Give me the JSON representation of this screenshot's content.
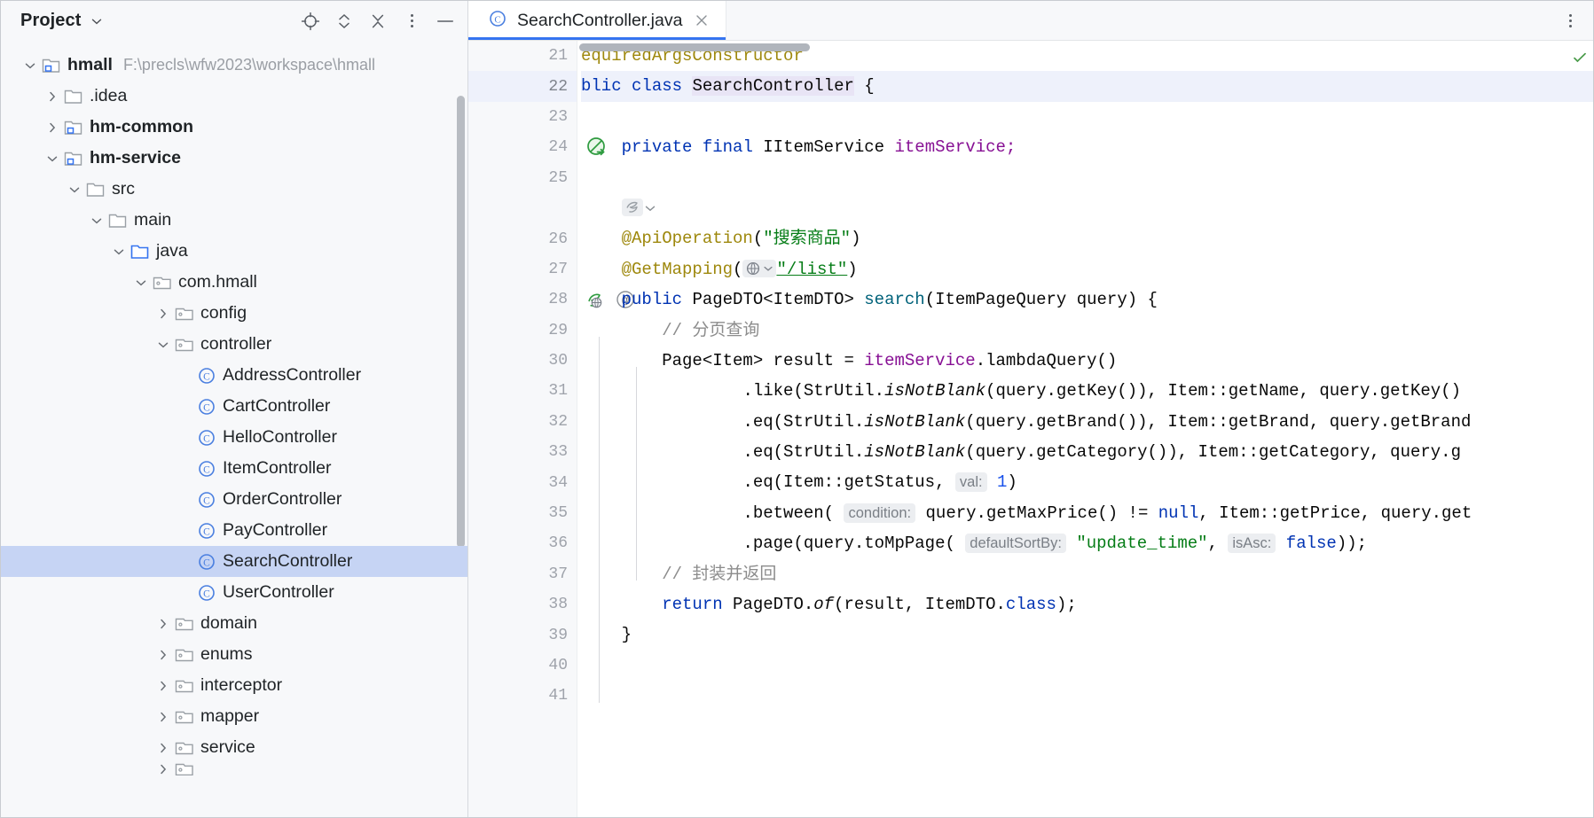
{
  "tool_window": {
    "title": "Project",
    "title_chevron_icon": "chevron-down-icon",
    "actions": [
      {
        "name": "locate-in-tree-icon",
        "label": "Select Opened File"
      },
      {
        "name": "expand-collapse-icon",
        "label": "Expand / Collapse"
      },
      {
        "name": "collapse-all-icon",
        "label": "Collapse All"
      },
      {
        "name": "more-options-icon",
        "label": "Options"
      },
      {
        "name": "hide-icon",
        "label": "Hide"
      }
    ]
  },
  "tree": {
    "nodes": [
      {
        "label": "hmall",
        "path": "F:\\precls\\wfw2023\\workspace\\hmall",
        "icon": "module-folder-icon",
        "depth": 0,
        "twisty": "expanded",
        "bold": true,
        "selected": false
      },
      {
        "label": ".idea",
        "path": "",
        "icon": "folder-icon",
        "depth": 1,
        "twisty": "collapsed",
        "bold": false,
        "selected": false
      },
      {
        "label": "hm-common",
        "path": "",
        "icon": "module-folder-icon",
        "depth": 1,
        "twisty": "collapsed",
        "bold": true,
        "selected": false
      },
      {
        "label": "hm-service",
        "path": "",
        "icon": "module-folder-icon",
        "depth": 1,
        "twisty": "expanded",
        "bold": true,
        "selected": false
      },
      {
        "label": "src",
        "path": "",
        "icon": "folder-icon",
        "depth": 2,
        "twisty": "expanded",
        "bold": false,
        "selected": false
      },
      {
        "label": "main",
        "path": "",
        "icon": "folder-icon",
        "depth": 3,
        "twisty": "expanded",
        "bold": false,
        "selected": false
      },
      {
        "label": "java",
        "path": "",
        "icon": "source-root-folder-icon",
        "depth": 4,
        "twisty": "expanded",
        "bold": false,
        "selected": false
      },
      {
        "label": "com.hmall",
        "path": "",
        "icon": "package-icon",
        "depth": 5,
        "twisty": "expanded",
        "bold": false,
        "selected": false
      },
      {
        "label": "config",
        "path": "",
        "icon": "package-icon",
        "depth": 6,
        "twisty": "collapsed",
        "bold": false,
        "selected": false
      },
      {
        "label": "controller",
        "path": "",
        "icon": "package-icon",
        "depth": 6,
        "twisty": "expanded",
        "bold": false,
        "selected": false
      },
      {
        "label": "AddressController",
        "path": "",
        "icon": "java-class-icon",
        "depth": 7,
        "twisty": "none",
        "bold": false,
        "selected": false
      },
      {
        "label": "CartController",
        "path": "",
        "icon": "java-class-icon",
        "depth": 7,
        "twisty": "none",
        "bold": false,
        "selected": false
      },
      {
        "label": "HelloController",
        "path": "",
        "icon": "java-class-icon",
        "depth": 7,
        "twisty": "none",
        "bold": false,
        "selected": false
      },
      {
        "label": "ItemController",
        "path": "",
        "icon": "java-class-icon",
        "depth": 7,
        "twisty": "none",
        "bold": false,
        "selected": false
      },
      {
        "label": "OrderController",
        "path": "",
        "icon": "java-class-icon",
        "depth": 7,
        "twisty": "none",
        "bold": false,
        "selected": false
      },
      {
        "label": "PayController",
        "path": "",
        "icon": "java-class-icon",
        "depth": 7,
        "twisty": "none",
        "bold": false,
        "selected": false
      },
      {
        "label": "SearchController",
        "path": "",
        "icon": "java-class-icon",
        "depth": 7,
        "twisty": "none",
        "bold": false,
        "selected": true
      },
      {
        "label": "UserController",
        "path": "",
        "icon": "java-class-icon",
        "depth": 7,
        "twisty": "none",
        "bold": false,
        "selected": false
      },
      {
        "label": "domain",
        "path": "",
        "icon": "package-icon",
        "depth": 6,
        "twisty": "collapsed",
        "bold": false,
        "selected": false
      },
      {
        "label": "enums",
        "path": "",
        "icon": "package-icon",
        "depth": 6,
        "twisty": "collapsed",
        "bold": false,
        "selected": false
      },
      {
        "label": "interceptor",
        "path": "",
        "icon": "package-icon",
        "depth": 6,
        "twisty": "collapsed",
        "bold": false,
        "selected": false
      },
      {
        "label": "mapper",
        "path": "",
        "icon": "package-icon",
        "depth": 6,
        "twisty": "collapsed",
        "bold": false,
        "selected": false
      },
      {
        "label": "service",
        "path": "",
        "icon": "package-icon",
        "depth": 6,
        "twisty": "collapsed",
        "bold": false,
        "selected": false
      }
    ]
  },
  "editor": {
    "tab": {
      "label": "SearchController.java",
      "icon": "java-class-icon",
      "close_icon": "close-icon",
      "active": true
    },
    "options_icon": "more-options-icon",
    "gutter": {
      "line_numbers": [
        "21",
        "22",
        "23",
        "24",
        "25",
        "",
        "26",
        "27",
        "28",
        "29",
        "30",
        "31",
        "32",
        "33",
        "34",
        "35",
        "36",
        "37",
        "38",
        "39",
        "40",
        "41"
      ],
      "markers": [
        {
          "line": "22",
          "icon": "spring-bean-icon"
        },
        {
          "line": "24",
          "icon": "spring-autowired-icon"
        },
        {
          "line": "28",
          "icon": "spring-endpoint-icon"
        },
        {
          "line": "28",
          "icon": "annotation-at-icon"
        }
      ]
    },
    "inlay_hints": [
      "val:",
      "condition:",
      "defaultSortBy:",
      "isAsc:"
    ],
    "inline_icons": [
      "globe-icon",
      "chevron-down-icon",
      "spring-gutter-chevron-icon"
    ],
    "code_lines": [
      {
        "n": "21",
        "text": "equiredArgsConstructor"
      },
      {
        "n": "22",
        "text": "blic class SearchController {"
      },
      {
        "n": "23",
        "text": ""
      },
      {
        "n": "24",
        "text": "    private final IItemService itemService;"
      },
      {
        "n": "25",
        "text": ""
      },
      {
        "n": "26",
        "text": "    @ApiOperation(\"搜索商品\")"
      },
      {
        "n": "27",
        "text": "    @GetMapping(\"/list\")"
      },
      {
        "n": "28",
        "text": "    public PageDTO<ItemDTO> search(ItemPageQuery query) {"
      },
      {
        "n": "29",
        "text": "        // 分页查询"
      },
      {
        "n": "30",
        "text": "        Page<Item> result = itemService.lambdaQuery()"
      },
      {
        "n": "31",
        "text": "                .like(StrUtil.isNotBlank(query.getKey()), Item::getName, query.getKey()"
      },
      {
        "n": "32",
        "text": "                .eq(StrUtil.isNotBlank(query.getBrand()), Item::getBrand, query.getBrand"
      },
      {
        "n": "33",
        "text": "                .eq(StrUtil.isNotBlank(query.getCategory()), Item::getCategory, query.g"
      },
      {
        "n": "34",
        "text": "                .eq(Item::getStatus, val: 1)"
      },
      {
        "n": "35",
        "text": "                .between( condition: query.getMaxPrice() != null, Item::getPrice, query.get"
      },
      {
        "n": "36",
        "text": "                .page(query.toMpPage( defaultSortBy: \"update_time\", isAsc: false));"
      },
      {
        "n": "37",
        "text": "        // 封装并返回"
      },
      {
        "n": "38",
        "text": "        return PageDTO.of(result, ItemDTO.class);"
      },
      {
        "n": "39",
        "text": "    }"
      },
      {
        "n": "40",
        "text": ""
      },
      {
        "n": "41",
        "text": ""
      }
    ],
    "tokens": {
      "annotation_required_args": "equiredArgsConstructor",
      "kw_public_partial": "blic",
      "kw_class": "class",
      "class_name": "SearchController",
      "brace_open": "{",
      "kw_private": "private",
      "kw_final": "final",
      "type_iitemservice": "IItemService",
      "field_itemservice": "itemService;",
      "anno_apioperation": "@ApiOperation",
      "str_search_product": "\"搜索商品\"",
      "anno_getmapping": "@GetMapping",
      "str_list": "\"/list\"",
      "kw_public": "public",
      "type_pagedto": "PageDTO<ItemDTO>",
      "method_search": "search",
      "param_itempagequery": "(ItemPageQuery query) {",
      "comment_paging": "// 分页查询",
      "line30": "Page<Item> result = ",
      "line30_field": "itemService",
      "line30_rest": ".lambdaQuery()",
      "line31_a": ".like(StrUtil.",
      "line31_static": "isNotBlank",
      "line31_b": "(query.getKey()), Item::getName, query.getKey()",
      "line32_a": ".eq(StrUtil.",
      "line32_b": "(query.getBrand()), Item::getBrand, query.getBrand",
      "line33_a": ".eq(StrUtil.",
      "line33_b": "(query.getCategory()), Item::getCategory, query.g",
      "line34_a": ".eq(Item::getStatus, ",
      "hint_val": "val:",
      "line34_num": "1",
      "line34_b": ")",
      "line35_a": ".between( ",
      "hint_condition": "condition:",
      "line35_b": " query.getMaxPrice() != ",
      "kw_null": "null",
      "line35_c": ", Item::getPrice, query.get",
      "line36_a": ".page(query.toMpPage( ",
      "hint_default_sort": "defaultSortBy:",
      "str_update_time": "\"update_time\"",
      "line36_comma": ", ",
      "hint_is_asc": "isAsc:",
      "kw_false": "false",
      "line36_end": "));",
      "comment_wrap_return": "// 封装并返回",
      "kw_return": "return",
      "line38_a": " PageDTO.",
      "line38_of": "of",
      "line38_b": "(result, ItemDTO.",
      "kw_class2": "class",
      "line38_c": ");",
      "brace_close": "}"
    }
  },
  "colors": {
    "accent": "#3574f0",
    "selection": "#c6d4f4",
    "current_line": "#eef1fb",
    "keyword": "#0033b3",
    "annotation": "#9e880d",
    "string": "#067d17",
    "number": "#1750eb",
    "comment": "#8c8c8c",
    "field": "#871094",
    "method": "#00627a",
    "hint_bg": "#eceef1",
    "panel_bg": "#f7f8fa",
    "editor_bg": "#ffffff"
  }
}
